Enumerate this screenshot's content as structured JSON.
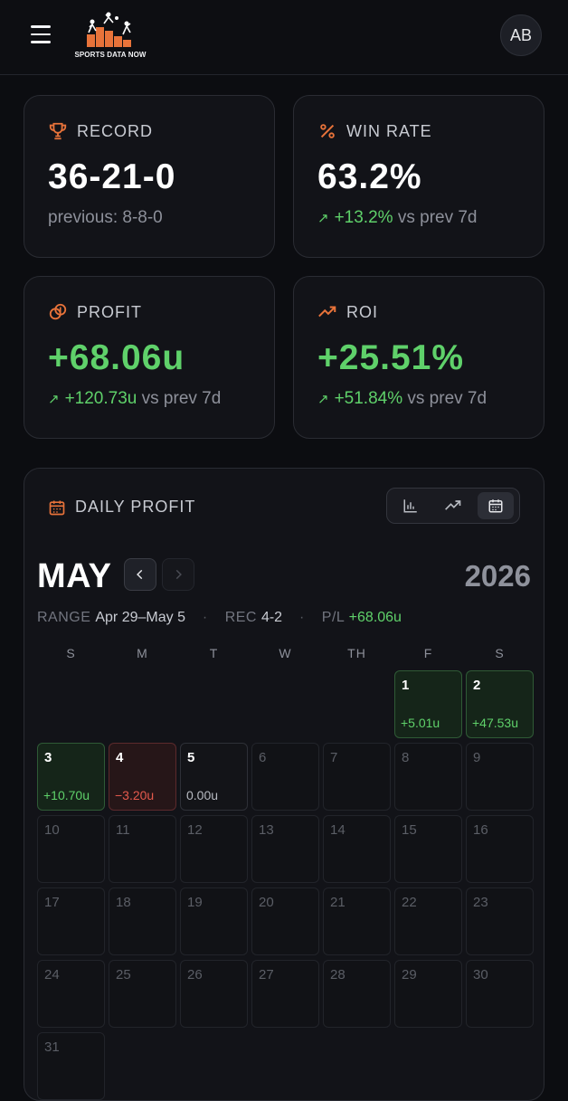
{
  "header": {
    "logo_text": "SPORTS DATA NOW",
    "avatar_initials": "AB"
  },
  "stats": {
    "record": {
      "label": "RECORD",
      "value": "36-21-0",
      "sub": "previous: 8-8-0"
    },
    "win_rate": {
      "label": "WIN RATE",
      "value": "63.2%",
      "delta": "+13.2%",
      "compare": "vs prev 7d"
    },
    "profit": {
      "label": "PROFIT",
      "value": "+68.06u",
      "delta": "+120.73u",
      "compare": "vs prev 7d"
    },
    "roi": {
      "label": "ROI",
      "value": "+25.51%",
      "delta": "+51.84%",
      "compare": "vs prev 7d"
    }
  },
  "calendar": {
    "title": "DAILY PROFIT",
    "month": "MAY",
    "year": "2026",
    "summary": {
      "range_label": "RANGE",
      "range_value": "Apr 29–May 5",
      "rec_label": "REC",
      "rec_value": "4-2",
      "pl_label": "P/L",
      "pl_value": "+68.06u"
    },
    "weekdays": [
      "S",
      "M",
      "T",
      "W",
      "TH",
      "F",
      "S"
    ],
    "first_weekday": 5,
    "days_in_month": 31,
    "results": {
      "1": {
        "pl": "+5.01u",
        "status": "win"
      },
      "2": {
        "pl": "+47.53u",
        "status": "win"
      },
      "3": {
        "pl": "+10.70u",
        "status": "win"
      },
      "4": {
        "pl": "−3.20u",
        "status": "loss"
      },
      "5": {
        "pl": "0.00u",
        "status": "even"
      }
    }
  },
  "colors": {
    "accent": "#e8733a",
    "positive": "#5fd16a",
    "negative": "#e55a4d",
    "background": "#0c0d11"
  },
  "icons": {
    "menu": "hamburger-icon",
    "record": "trophy-icon",
    "win_rate": "percent-icon",
    "profit": "coins-icon",
    "roi": "trending-up-icon",
    "calendar": "calendar-icon"
  }
}
